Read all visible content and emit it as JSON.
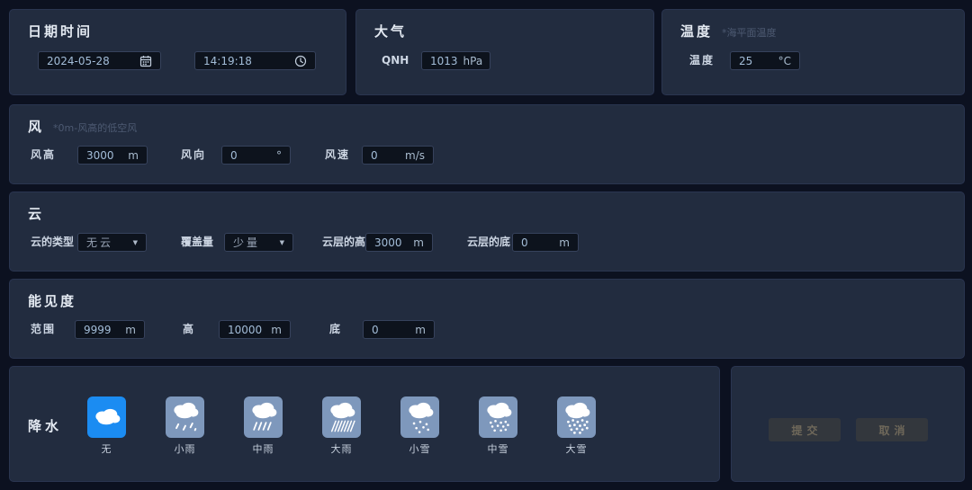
{
  "colors": {
    "accent": "#1b8cf2",
    "tile": "#7e98bc",
    "panel": "#222c3f",
    "background": "#0c1120",
    "input_bg": "#0d131d",
    "input_text": "#a3bdd8"
  },
  "panels": {
    "datetime": {
      "title": "日期时间",
      "date": {
        "value": "2024-05-28",
        "icon": "calendar-icon"
      },
      "time": {
        "value": "14:19:18",
        "icon": "clock-icon"
      }
    },
    "atmosphere": {
      "title": "大气",
      "qnh": {
        "label": "QNH",
        "value": "1013",
        "unit": "hPa"
      }
    },
    "temperature": {
      "title": "温度",
      "note": "*海平面温度",
      "temp": {
        "label": "温度",
        "value": "25",
        "unit": "°C"
      }
    },
    "wind": {
      "title": "风",
      "note": "*0m-风高的低空风",
      "fields": [
        {
          "label": "风高",
          "value": "3000",
          "unit": "m"
        },
        {
          "label": "风向",
          "value": "0",
          "unit": "°"
        },
        {
          "label": "风速",
          "value": "0",
          "unit": "m/s"
        }
      ]
    },
    "cloud": {
      "title": "云",
      "type": {
        "label": "云的类型",
        "value": "无云"
      },
      "coverage": {
        "label": "覆盖量",
        "value": "少量"
      },
      "top": {
        "label": "云层的高",
        "value": "3000",
        "unit": "m"
      },
      "base": {
        "label": "云层的底",
        "value": "0",
        "unit": "m"
      }
    },
    "visibility": {
      "title": "能见度",
      "fields": [
        {
          "label": "范围",
          "value": "9999",
          "unit": "m"
        },
        {
          "label": "高",
          "value": "10000",
          "unit": "m"
        },
        {
          "label": "底",
          "value": "0",
          "unit": "m"
        }
      ]
    },
    "precipitation": {
      "title": "降水",
      "options": [
        {
          "label": "无",
          "icon": "cloud-icon",
          "selected": true
        },
        {
          "label": "小雨",
          "icon": "light-rain-icon",
          "selected": false
        },
        {
          "label": "中雨",
          "icon": "medium-rain-icon",
          "selected": false
        },
        {
          "label": "大雨",
          "icon": "heavy-rain-icon",
          "selected": false
        },
        {
          "label": "小雪",
          "icon": "light-snow-icon",
          "selected": false
        },
        {
          "label": "中雪",
          "icon": "medium-snow-icon",
          "selected": false
        },
        {
          "label": "大雪",
          "icon": "heavy-snow-icon",
          "selected": false
        }
      ]
    },
    "actions": {
      "submit_label": "提交",
      "cancel_label": "取消"
    }
  }
}
